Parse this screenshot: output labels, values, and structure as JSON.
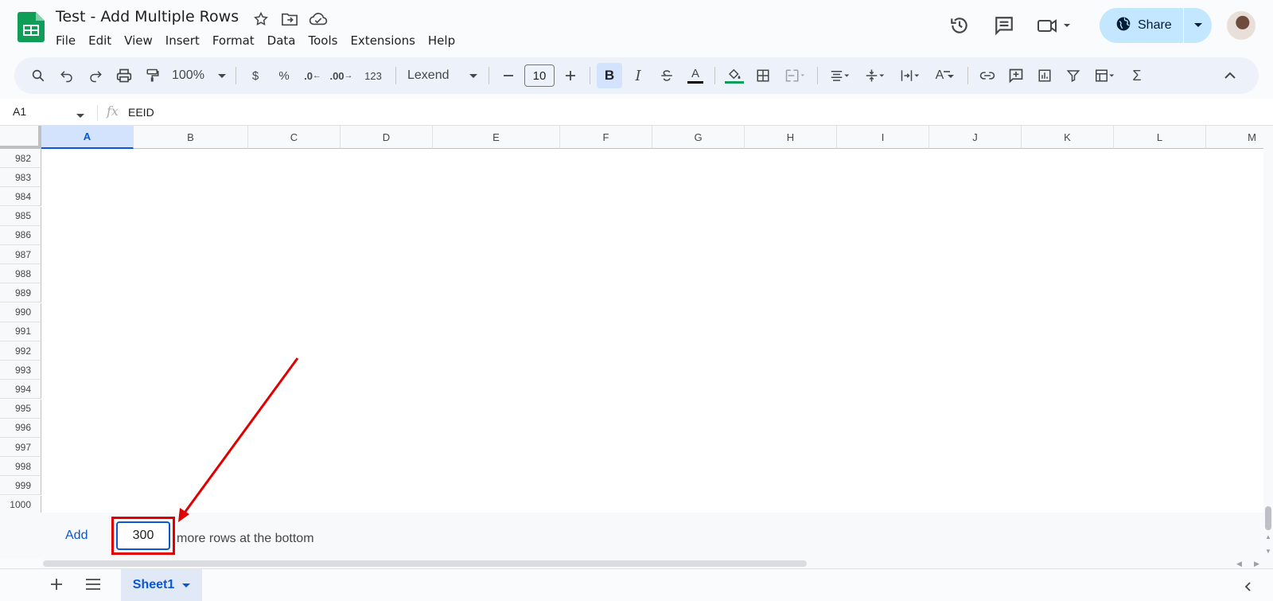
{
  "doc": {
    "title": "Test - Add Multiple Rows"
  },
  "menu": [
    "File",
    "Edit",
    "View",
    "Insert",
    "Format",
    "Data",
    "Tools",
    "Extensions",
    "Help"
  ],
  "share": {
    "label": "Share"
  },
  "toolbar": {
    "zoom": "100%",
    "currency": "$",
    "percent": "%",
    "dec_decrease": ".0",
    "dec_increase": ".00",
    "number_format": "123",
    "font": "Lexend",
    "font_size": "10",
    "bold": "B",
    "italic": "I",
    "text_color": "A",
    "rotate_text": "A",
    "functions": "Σ"
  },
  "formula_bar": {
    "cell_ref": "A1",
    "fx": "fx",
    "value": "EEID"
  },
  "columns": [
    "A",
    "B",
    "C",
    "D",
    "E",
    "F",
    "G",
    "H",
    "I",
    "J",
    "K",
    "L",
    "M"
  ],
  "rows": [
    "982",
    "983",
    "984",
    "985",
    "986",
    "987",
    "988",
    "989",
    "990",
    "991",
    "992",
    "993",
    "994",
    "995",
    "996",
    "997",
    "998",
    "999",
    "1000"
  ],
  "add_rows": {
    "button": "Add",
    "count": "300",
    "suffix": "more rows at the bottom"
  },
  "sheets": [
    {
      "name": "Sheet1"
    }
  ],
  "colors": {
    "accent": "#0b57d0",
    "selected_header": "#d3e3fd",
    "annotation": "#e00000",
    "share_bg": "#c2e7ff",
    "sheets_green": "#0f9d58"
  }
}
